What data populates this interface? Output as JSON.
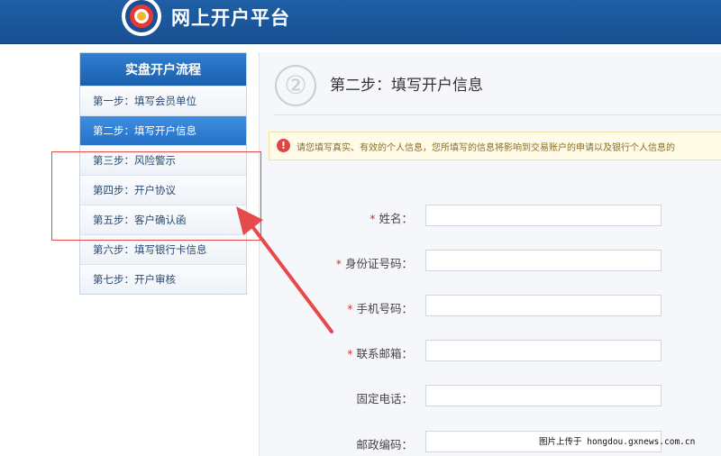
{
  "header": {
    "platform_title": "网上开户平台"
  },
  "sidebar": {
    "title": "实盘开户流程",
    "steps": [
      {
        "label": "第一步：填写会员单位"
      },
      {
        "label": "第二步：填写开户信息"
      },
      {
        "label": "第三步：风险警示"
      },
      {
        "label": "第四步：开户协议"
      },
      {
        "label": "第五步：客户确认函"
      },
      {
        "label": "第六步：填写银行卡信息"
      },
      {
        "label": "第七步：开户审核"
      }
    ]
  },
  "main": {
    "step_number": "②",
    "step_title": "第二步：填写开户信息",
    "notice": "请您填写真实、有效的个人信息，您所填写的信息将影响到交易账户的申请以及银行个人信息的",
    "fields": [
      {
        "label": "姓名：",
        "required": "*",
        "value": ""
      },
      {
        "label": "身份证号码：",
        "required": "*",
        "value": ""
      },
      {
        "label": "手机号码：",
        "required": "*",
        "value": ""
      },
      {
        "label": "联系邮箱：",
        "required": "*",
        "value": ""
      },
      {
        "label": "固定电话：",
        "required": "",
        "value": ""
      },
      {
        "label": "邮政编码：",
        "required": "",
        "value": ""
      }
    ]
  },
  "watermark": "图片上传于 hongdou.gxnews.com.cn",
  "colors": {
    "header": "#1f5fa6",
    "active_step": "#2f7fd2",
    "annotation": "#e54b4b"
  }
}
